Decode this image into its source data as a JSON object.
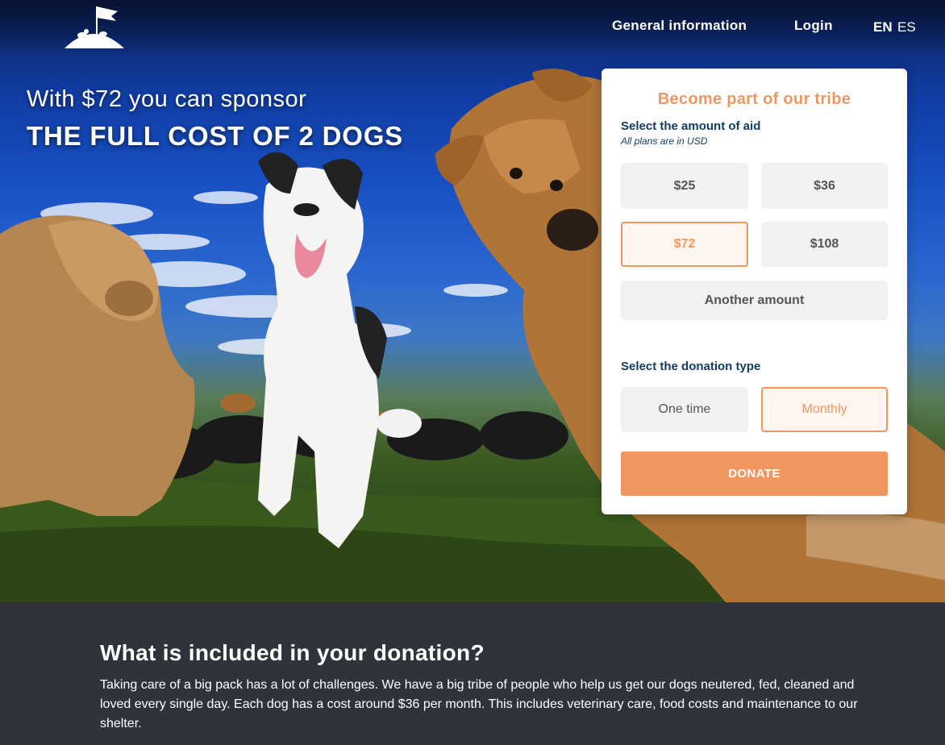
{
  "nav": {
    "general_information": "General information",
    "login": "Login",
    "lang_en": "EN",
    "lang_es": "ES"
  },
  "hero": {
    "line1": "With $72 you can sponsor",
    "line2": "THE FULL COST OF 2 DOGS"
  },
  "card": {
    "title": "Become part of our tribe",
    "amount_title": "Select the amount of aid",
    "amount_note": "All plans are in USD",
    "amounts": [
      "$25",
      "$36",
      "$72",
      "$108"
    ],
    "selected_amount": "$72",
    "another_amount": "Another amount",
    "type_title": "Select the donation type",
    "type_one_time": "One time",
    "type_monthly": "Monthly",
    "selected_type": "Monthly",
    "donate_label": "DONATE"
  },
  "info": {
    "title": "What is included in your donation?",
    "body": "Taking care of a big pack has a lot of challenges. We have a big tribe of people who help us get our dogs neutered, fed, cleaned and loved every single day. Each dog has a cost around $36 per month. This includes veterinary care, food costs and maintenance to our shelter."
  },
  "colors": {
    "accent": "#f0965f",
    "heading_blue": "#123d67",
    "section_bg": "#2f333b"
  },
  "icons": [
    "shelter-logo-icon"
  ]
}
